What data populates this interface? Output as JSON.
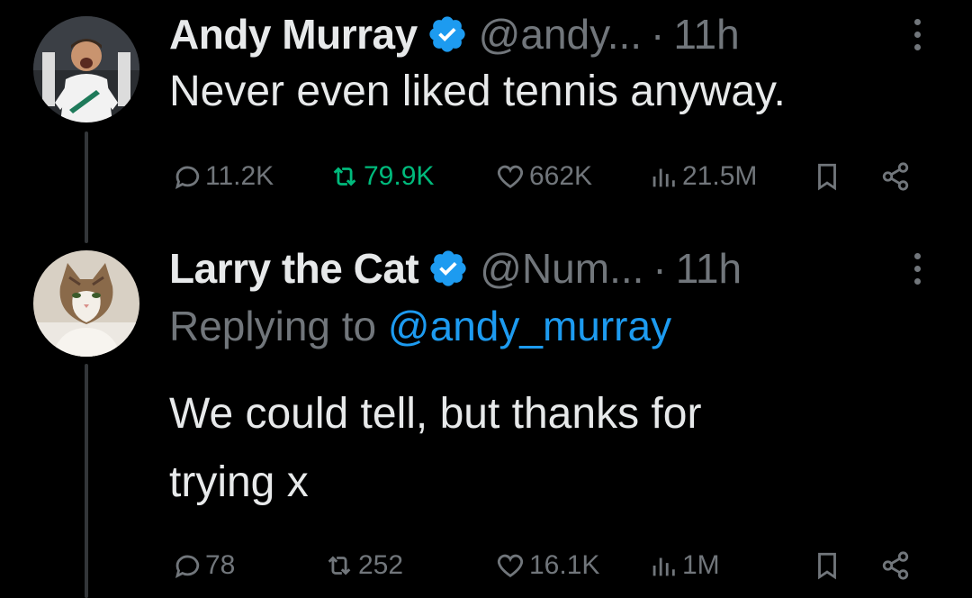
{
  "tweets": [
    {
      "author": "Andy Murray",
      "handle": "@andy...",
      "separator": "·",
      "time": "11h",
      "text": "Never even liked tennis anyway.",
      "stats": {
        "replies": "11.2K",
        "retweets": "79.9K",
        "likes": "662K",
        "views": "21.5M"
      },
      "retweeted": true
    },
    {
      "author": "Larry the Cat",
      "handle": "@Num...",
      "separator": "·",
      "time": "11h",
      "replying_prefix": "Replying to",
      "replying_handle": "@andy_murray",
      "text_line1": "We could tell, but thanks for",
      "text_line2": "trying x",
      "stats": {
        "replies": "78",
        "retweets": "252",
        "likes": "16.1K",
        "views": "1M"
      }
    }
  ],
  "colors": {
    "background": "#000000",
    "text": "#e7e9ea",
    "muted": "#71767b",
    "accent": "#1d9bf0",
    "retweet_active": "#00ba7c"
  },
  "icons": [
    "verified-badge-icon",
    "more-options-icon",
    "reply-icon",
    "retweet-icon",
    "like-icon",
    "views-icon",
    "bookmark-icon",
    "share-icon"
  ]
}
